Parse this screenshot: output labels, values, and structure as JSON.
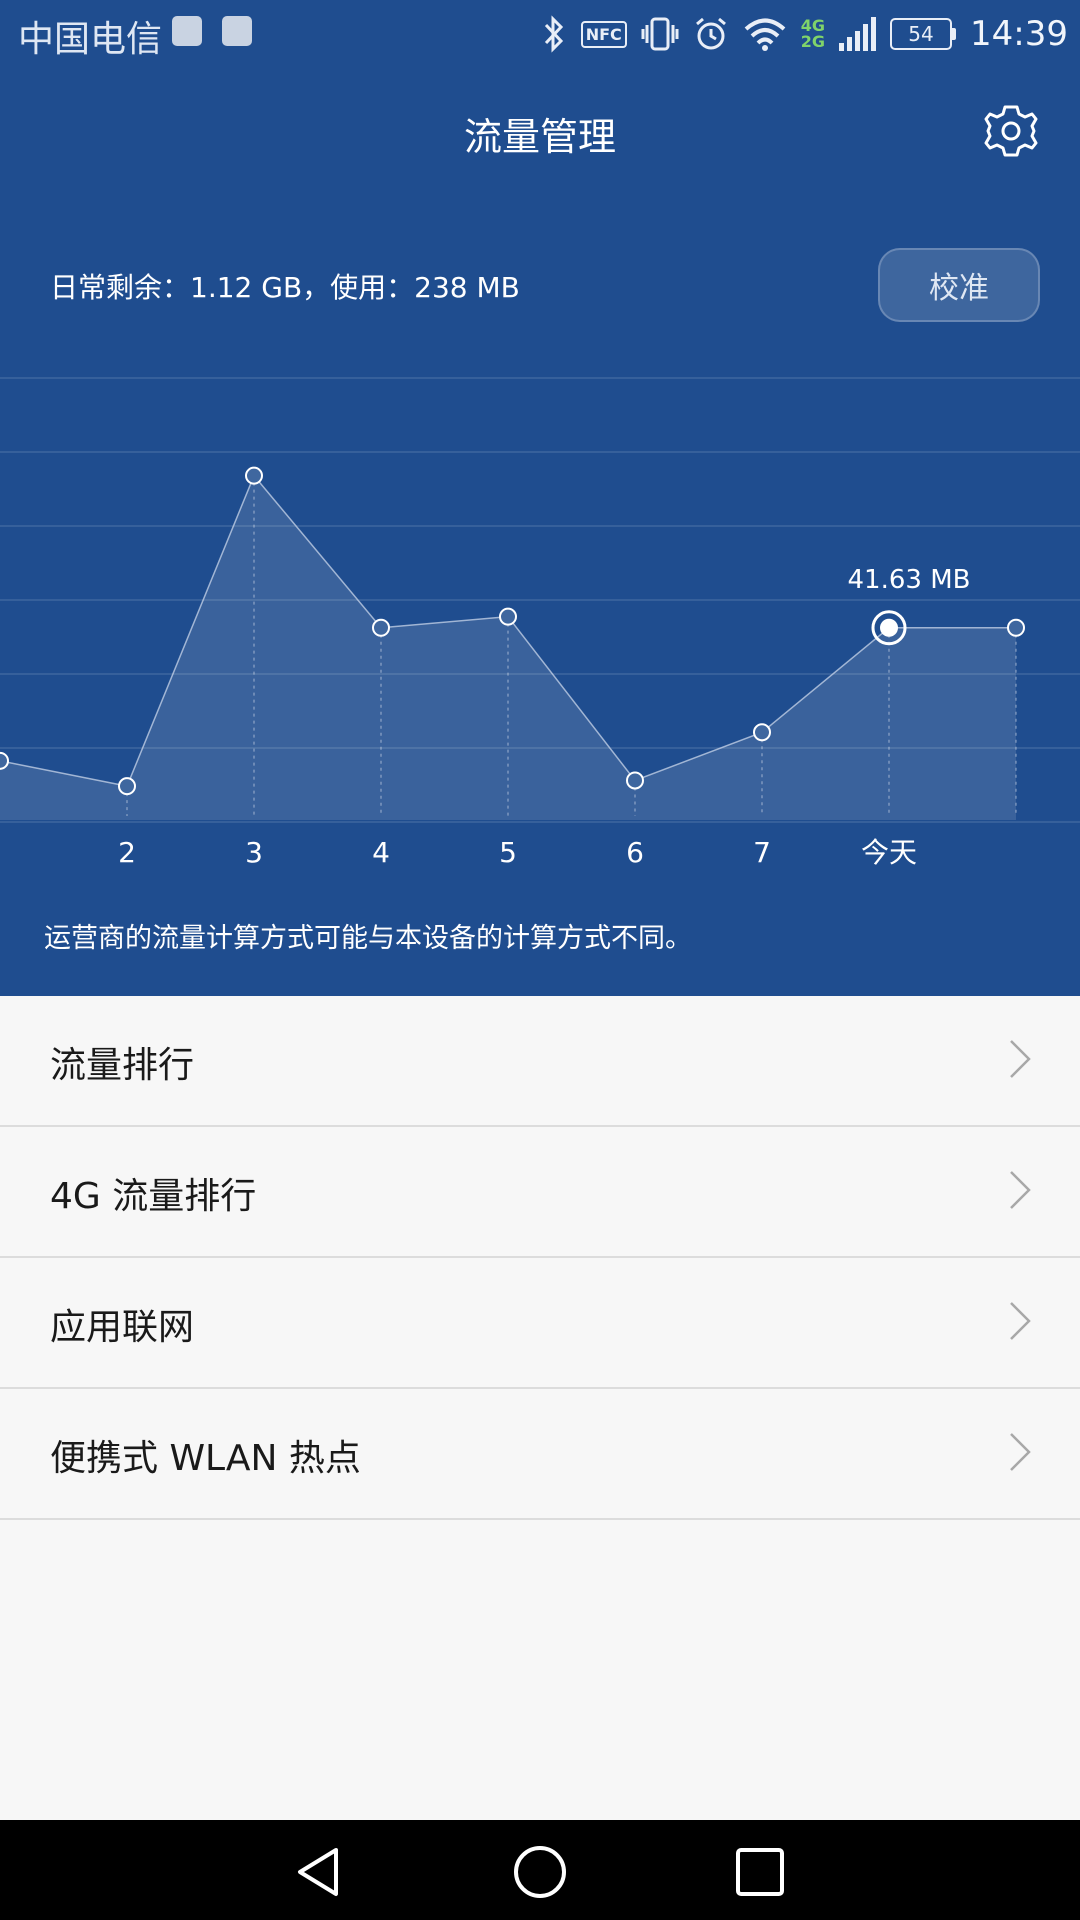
{
  "status_bar": {
    "carrier": "中国电信",
    "app_icons": [
      "health-app-icon",
      "emui-app-icon"
    ],
    "nfc_label": "NFC",
    "network_type_top": "4G",
    "network_type_bottom": "2G",
    "battery_level": "54",
    "time": "14:39"
  },
  "title_bar": {
    "title": "流量管理",
    "settings_icon": "gear-icon"
  },
  "summary": {
    "text": "日常剩余：1.12 GB，使用：238 MB",
    "calibrate_label": "校准"
  },
  "chart_data": {
    "type": "line",
    "categories": [
      "",
      "2",
      "3",
      "4",
      "5",
      "6",
      "7",
      "今天",
      ""
    ],
    "values": [
      10,
      2,
      100,
      52,
      55.5,
      3.8,
      19,
      52,
      52
    ],
    "highlight_index": 7,
    "highlight_label": "41.63 MB",
    "ylim": [
      -3,
      110
    ],
    "grid": true,
    "colors": {
      "line": "#c9d6ea",
      "fill": "#ffffff",
      "grid": "#3f679f"
    }
  },
  "note": "运营商的流量计算方式可能与本设备的计算方式不同。",
  "menu": [
    {
      "label": "流量排行",
      "icon": "chevron-right-icon"
    },
    {
      "label": "4G 流量排行",
      "icon": "chevron-right-icon"
    },
    {
      "label": "应用联网",
      "icon": "chevron-right-icon"
    },
    {
      "label": "便携式 WLAN 热点",
      "icon": "chevron-right-icon"
    }
  ],
  "nav_bar": {
    "icons": [
      "back-icon",
      "home-icon",
      "recents-icon"
    ]
  },
  "colors": {
    "header_bg": "#1f4d8f",
    "page_bg": "#f7f7f7",
    "nav_bg": "#000000"
  }
}
